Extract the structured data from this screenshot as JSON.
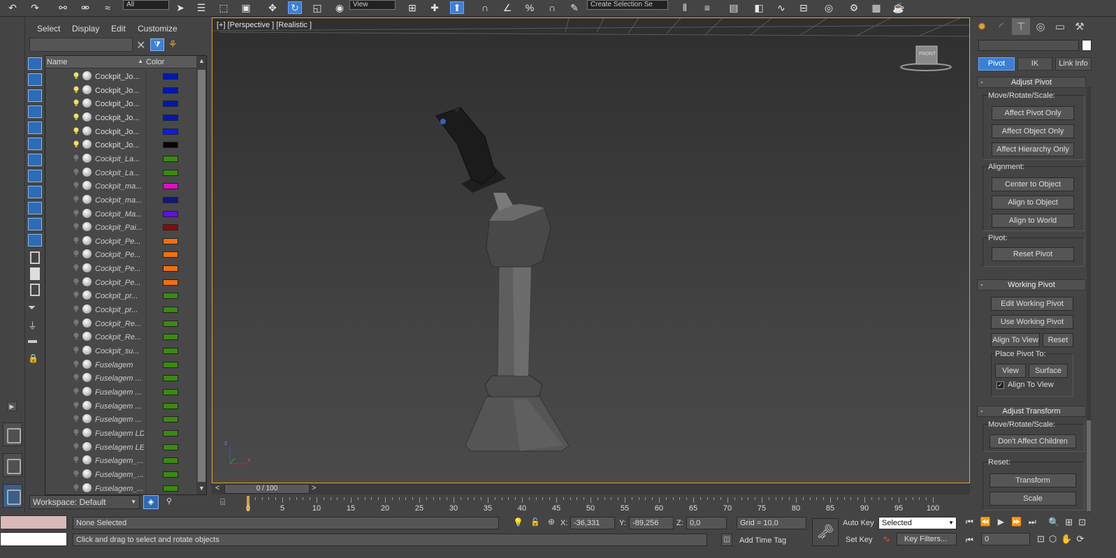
{
  "scene_explorer": {
    "menu": [
      "Select",
      "Display",
      "Edit",
      "Customize"
    ],
    "columns": {
      "name": "Name",
      "color": "Color"
    },
    "rows": [
      {
        "name": "Cockpit_Jo...",
        "color": "#0018b4",
        "italic": false,
        "light": true
      },
      {
        "name": "Cockpit_Jo...",
        "color": "#0018b4",
        "italic": false,
        "light": true
      },
      {
        "name": "Cockpit_Jo...",
        "color": "#0018b4",
        "italic": false,
        "light": true
      },
      {
        "name": "Cockpit_Jo...",
        "color": "#0018b4",
        "italic": false,
        "light": true
      },
      {
        "name": "Cockpit_Jo...",
        "color": "#0a1ee6",
        "italic": false,
        "light": true
      },
      {
        "name": "Cockpit_Jo...",
        "color": "#050505",
        "italic": false,
        "light": true
      },
      {
        "name": "Cockpit_La...",
        "color": "#3a8a10",
        "italic": true,
        "light": false
      },
      {
        "name": "Cockpit_La...",
        "color": "#3a8a10",
        "italic": true,
        "light": false
      },
      {
        "name": "Cockpit_ma...",
        "color": "#e010c8",
        "italic": true,
        "light": false
      },
      {
        "name": "Cockpit_ma...",
        "color": "#101880",
        "italic": true,
        "light": false
      },
      {
        "name": "Cockpit_Ma...",
        "color": "#6010e0",
        "italic": true,
        "light": false
      },
      {
        "name": "Cockpit_Pai...",
        "color": "#8a0a0a",
        "italic": true,
        "light": false
      },
      {
        "name": "Cockpit_Pe...",
        "color": "#f07010",
        "italic": true,
        "light": false
      },
      {
        "name": "Cockpit_Pe...",
        "color": "#f07010",
        "italic": true,
        "light": false
      },
      {
        "name": "Cockpit_Pe...",
        "color": "#f07010",
        "italic": true,
        "light": false
      },
      {
        "name": "Cockpit_Pe...",
        "color": "#f07010",
        "italic": true,
        "light": false
      },
      {
        "name": "Cockpit_pr...",
        "color": "#3a8a10",
        "italic": true,
        "light": false
      },
      {
        "name": "Cockpit_pr...",
        "color": "#3a8a10",
        "italic": true,
        "light": false
      },
      {
        "name": "Cockpit_Re...",
        "color": "#3a8a10",
        "italic": true,
        "light": false
      },
      {
        "name": "Cockpit_Re...",
        "color": "#3a8a10",
        "italic": true,
        "light": false
      },
      {
        "name": "Cockpit_su...",
        "color": "#3a8a10",
        "italic": true,
        "light": false
      },
      {
        "name": "Fuselagem",
        "color": "#3a8a10",
        "italic": true,
        "light": false
      },
      {
        "name": "Fuselagem ...",
        "color": "#3a8a10",
        "italic": true,
        "light": false
      },
      {
        "name": "Fuselagem ...",
        "color": "#3a8a10",
        "italic": true,
        "light": false
      },
      {
        "name": "Fuselagem ...",
        "color": "#3a8a10",
        "italic": true,
        "light": false
      },
      {
        "name": "Fuselagem ...",
        "color": "#3a8a10",
        "italic": true,
        "light": false
      },
      {
        "name": "Fuselagem LD",
        "color": "#3a8a10",
        "italic": true,
        "light": false
      },
      {
        "name": "Fuselagem LE",
        "color": "#3a8a10",
        "italic": true,
        "light": false
      },
      {
        "name": "Fuselagem_...",
        "color": "#3a8a10",
        "italic": true,
        "light": false
      },
      {
        "name": "Fuselagem_...",
        "color": "#3a8a10",
        "italic": true,
        "light": false
      },
      {
        "name": "Fuselagem_...",
        "color": "#3a8a10",
        "italic": true,
        "light": false
      }
    ],
    "workspace": "Workspace: Default"
  },
  "toolbar": {
    "selection_filter": "All",
    "reference_coord": "View",
    "named_selection": "Create Selection Se"
  },
  "viewport": {
    "label": "[+] [Perspective ] [Realistic ]",
    "viewcube_label": "FRONT",
    "axis_x": "x",
    "axis_z": "z"
  },
  "timeline": {
    "slider_text": "0 / 100",
    "prev": "<",
    "next": ">",
    "ticks": [
      "0",
      "5",
      "10",
      "15",
      "20",
      "25",
      "30",
      "35",
      "40",
      "45",
      "50",
      "55",
      "60",
      "65",
      "70",
      "75",
      "80",
      "85",
      "90",
      "95",
      "100"
    ]
  },
  "command_panel": {
    "tabs": [
      "Pivot",
      "IK",
      "Link Info"
    ],
    "adjust_pivot": {
      "title": "Adjust Pivot",
      "move_label": "Move/Rotate/Scale:",
      "buttons": [
        "Affect Pivot Only",
        "Affect Object Only",
        "Affect Hierarchy Only"
      ],
      "alignment_label": "Alignment:",
      "alignment_buttons": [
        "Center to Object",
        "Align to Object",
        "Align to World"
      ],
      "pivot_label": "Pivot:",
      "reset_pivot": "Reset Pivot"
    },
    "working_pivot": {
      "title": "Working Pivot",
      "edit": "Edit Working Pivot",
      "use": "Use Working Pivot",
      "align_to_view": "Align To View",
      "reset": "Reset",
      "place_label": "Place Pivot To:",
      "view": "View",
      "surface": "Surface",
      "align_check": "Align To View"
    },
    "adjust_transform": {
      "title": "Adjust Transform",
      "move_label": "Move/Rotate/Scale:",
      "dont_affect": "Don't Affect Children",
      "reset_label": "Reset:",
      "transform": "Transform",
      "scale": "Scale"
    }
  },
  "status": {
    "selection": "None Selected",
    "prompt": "Click and drag to select and rotate objects",
    "x_label": "X:",
    "x_value": "-36,331",
    "y_label": "Y:",
    "y_value": "-89,256",
    "z_label": "Z:",
    "z_value": "0,0",
    "grid": "Grid = 10,0",
    "add_time_tag": "Add Time Tag",
    "auto_key": "Auto Key",
    "set_key": "Set Key",
    "key_mode": "Selected",
    "key_filters": "Key Filters...",
    "frame": "0"
  }
}
